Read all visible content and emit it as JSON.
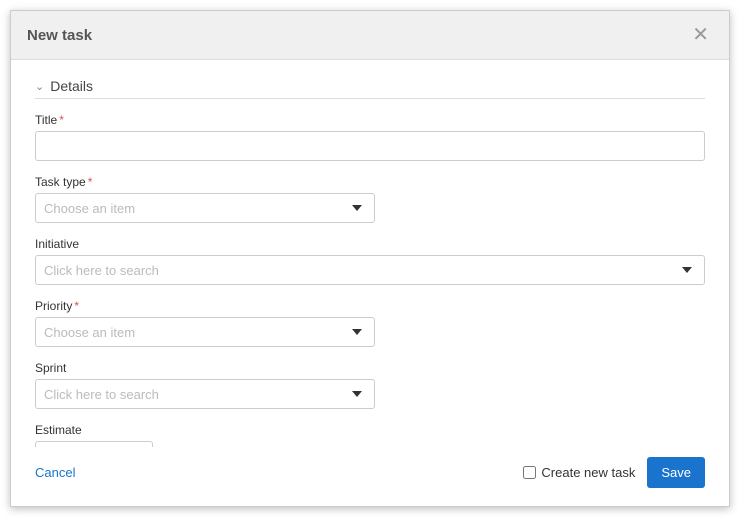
{
  "modal": {
    "title": "New task"
  },
  "section": {
    "details_label": "Details"
  },
  "fields": {
    "title": {
      "label": "Title",
      "value": ""
    },
    "task_type": {
      "label": "Task type",
      "placeholder": "Choose an item"
    },
    "initiative": {
      "label": "Initiative",
      "placeholder": "Click here to search"
    },
    "priority": {
      "label": "Priority",
      "placeholder": "Choose an item"
    },
    "sprint": {
      "label": "Sprint",
      "placeholder": "Click here to search"
    },
    "estimate": {
      "label": "Estimate",
      "value": ""
    }
  },
  "footer": {
    "cancel": "Cancel",
    "create_new_task": "Create new task",
    "save": "Save"
  }
}
